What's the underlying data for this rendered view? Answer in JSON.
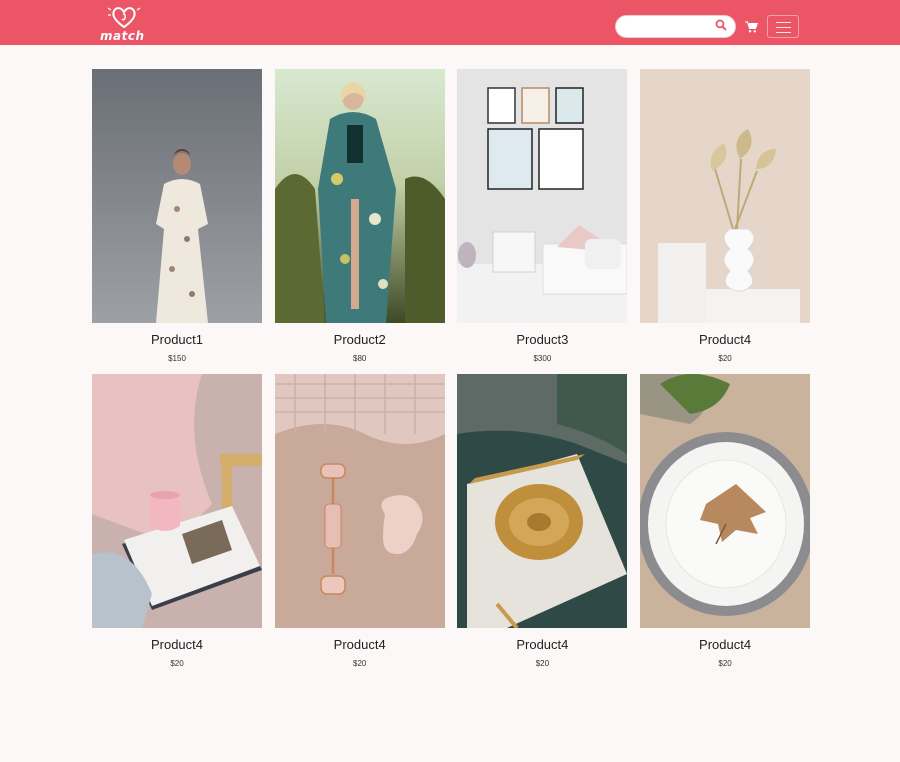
{
  "header": {
    "logo_text": "match",
    "search": {
      "value": "",
      "placeholder": ""
    },
    "icons": [
      "heart-logo-icon",
      "search-icon",
      "cart-icon",
      "hamburger-menu-icon"
    ]
  },
  "colors": {
    "brand": "#ec5566",
    "background": "#fdf8f8"
  },
  "products": [
    {
      "name": "Product1",
      "price": "$150",
      "image": "woman-floral-dress"
    },
    {
      "name": "Product2",
      "price": "$80",
      "image": "woman-kimono-grass"
    },
    {
      "name": "Product3",
      "price": "$300",
      "image": "room-wall-frames"
    },
    {
      "name": "Product4",
      "price": "$20",
      "image": "white-vase-dried-leaves"
    },
    {
      "name": "Product4",
      "price": "$20",
      "image": "pink-mug-magazine"
    },
    {
      "name": "Product4",
      "price": "$20",
      "image": "rose-quartz-roller"
    },
    {
      "name": "Product4",
      "price": "$20",
      "image": "gold-dish-marble"
    },
    {
      "name": "Product4",
      "price": "$20",
      "image": "plate-leaf-card"
    }
  ]
}
